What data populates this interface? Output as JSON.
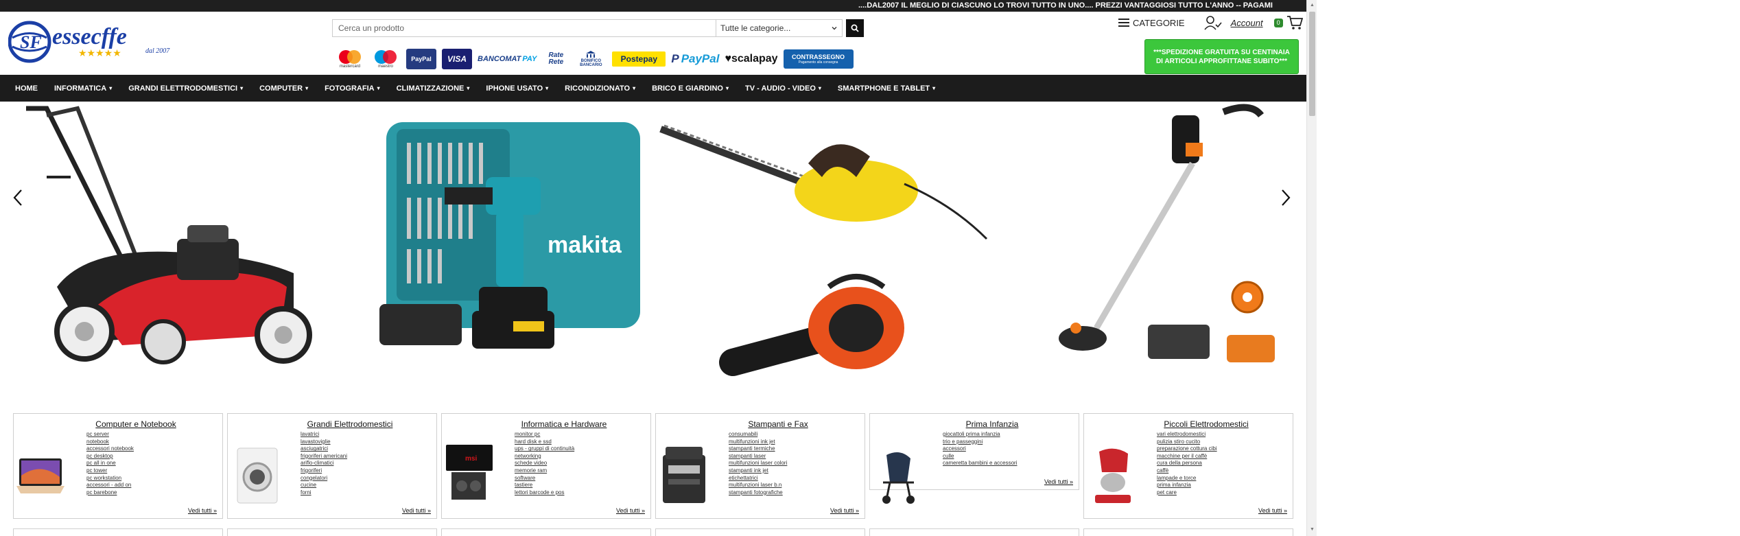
{
  "marquee": {
    "text": "....DAL2007 IL MEGLIO DI CIASCUNO LO TROVI TUTTO IN UNO.... PREZZI VANTAGGIOSI TUTTO L'ANNO -- PAGAMI"
  },
  "logo": {
    "name": "essecffe",
    "tagline": "dal 2007",
    "stars": "★★★★★",
    "mark": "SF"
  },
  "search": {
    "placeholder": "Cerca un prodotto",
    "category": "Tutte le categorie..."
  },
  "payments": {
    "mastercard": "mastercard",
    "maestro": "maestro",
    "paypal_small": "PayPal",
    "visa": "VISA",
    "bancomat": "BANCOMAT",
    "bancomat_pay": "PAY",
    "rate": "Rate Rete",
    "bonifico": "BONIFICO BANCARIO",
    "postepay": "Postepay",
    "paypal_logo_p": "P",
    "paypal_logo_text": "PayPal",
    "scalapay": "♥scalapay",
    "contrassegno": "CONTRASSEGNO",
    "contrassegno_sub": "Pagamento alla consegna"
  },
  "header": {
    "categorie": "CATEGORIE",
    "account": "Account",
    "cart_count": "0"
  },
  "shipping_banner": "***SPEDIZIONE GRATUITA SU CENTINAIA DI ARTICOLI APPROFITTANE SUBITO***",
  "nav": [
    "HOME",
    "INFORMATICA",
    "GRANDI ELETTRODOMESTICI",
    "COMPUTER",
    "FOTOGRAFIA",
    "CLIMATIZZAZIONE",
    "IPHONE USATO",
    "RICONDIZIONATO",
    "BRICO E GIARDINO",
    "TV - AUDIO - VIDEO",
    "SMARTPHONE E TABLET"
  ],
  "nav_dropdown": [
    false,
    true,
    true,
    true,
    true,
    true,
    true,
    true,
    true,
    true,
    true
  ],
  "banner_products": {
    "drill_case_brand": "makita"
  },
  "categories": [
    {
      "title": "Computer e Notebook",
      "items": [
        "pc server",
        "notebook",
        "accessori notebook",
        "pc desktop",
        "pc all in one",
        "pc tower",
        "pc workstation",
        "accessori - add on",
        "pc barebone"
      ],
      "all": "Vedi tutti »"
    },
    {
      "title": "Grandi Elettrodomestici",
      "items": [
        "lavatrici",
        "lavastoviglie",
        "asciugatrici",
        "frigoriferi americani",
        "ariflo-climatici",
        "frigoriferi",
        "congelatori",
        "cucine",
        "forni"
      ],
      "all": "Vedi tutti »"
    },
    {
      "title": "Informatica e Hardware",
      "items": [
        "monitor pc",
        "hard disk e ssd",
        "ups - gruppi di continuità",
        "networking",
        "schede video",
        "memorie ram",
        "software",
        "tastiere",
        "lettori barcode e pos"
      ],
      "all": "Vedi tutti »"
    },
    {
      "title": "Stampanti e Fax",
      "items": [
        "consumabili",
        "multifunzioni ink jet",
        "stampanti termiche",
        "stampanti laser",
        "multifunzioni laser colori",
        "stampanti ink jet",
        "etichettatrici",
        "multifunzioni laser b.n",
        "stampanti fotografiche"
      ],
      "all": "Vedi tutti »"
    },
    {
      "title": "Prima Infanzia",
      "items": [
        "giocattoli prima infanzia",
        "trio e passeggini",
        "accessori",
        "culle",
        "cameretta bambini e accessori"
      ],
      "all": "Vedi tutti »"
    },
    {
      "title": "Piccoli Elettrodomestici",
      "items": [
        "vari elettrodomestici",
        "pulizia stiro cucito",
        "preparazione cottura cibi",
        "macchine per il caffè",
        "cura della persona",
        "caffè",
        "lampade e torce",
        "prima infanzia",
        "pet care"
      ],
      "all": "Vedi tutti »"
    }
  ],
  "colors": {
    "nav_bg": "#1c1c1c",
    "shipping_bg": "#3cc73c",
    "logo_blue": "#1b3fa6",
    "star_gold": "#f2b600"
  }
}
